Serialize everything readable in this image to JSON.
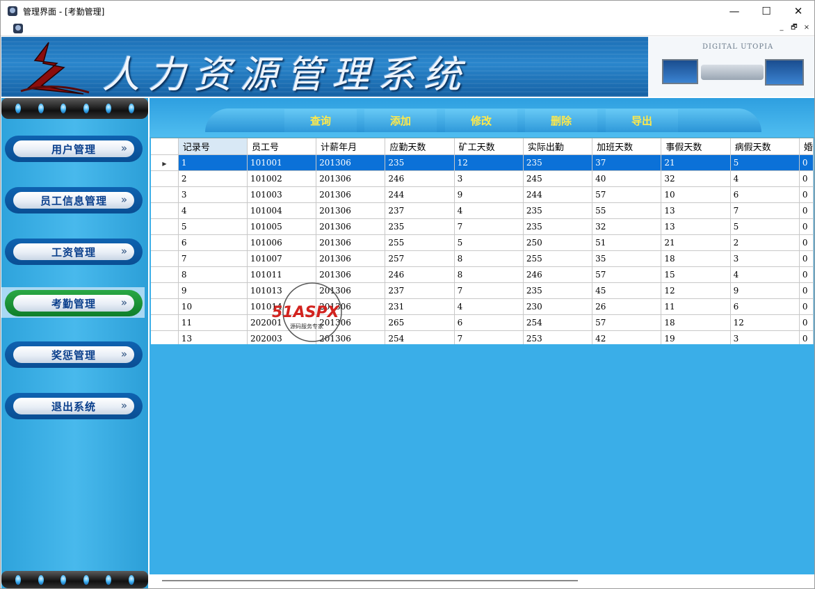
{
  "window": {
    "title": "管理界面 - [考勤管理]",
    "controls": [
      "—",
      "☐",
      "✕"
    ],
    "mdi_controls": [
      "_",
      "🗗",
      "×"
    ]
  },
  "banner": {
    "title": "人力资源管理系统",
    "brand": "DIGITAL UTOPIA"
  },
  "sidebar": {
    "items": [
      {
        "label": "用户管理",
        "active": false
      },
      {
        "label": "员工信息管理",
        "active": false
      },
      {
        "label": "工资管理",
        "active": false
      },
      {
        "label": "考勤管理",
        "active": true
      },
      {
        "label": "奖惩管理",
        "active": false
      },
      {
        "label": "退出系统",
        "active": false
      }
    ],
    "chevron": "»"
  },
  "toolbar": {
    "buttons": [
      "查询",
      "添加",
      "修改",
      "删除",
      "导出"
    ]
  },
  "grid": {
    "columns": [
      "记录号",
      "员工号",
      "计薪年月",
      "应勤天数",
      "矿工天数",
      "实际出勤",
      "加班天数",
      "事假天数",
      "病假天数",
      "婚"
    ],
    "rows": [
      [
        "1",
        "101001",
        "201306",
        "235",
        "12",
        "235",
        "37",
        "21",
        "5",
        "0"
      ],
      [
        "2",
        "101002",
        "201306",
        "246",
        "3",
        "245",
        "40",
        "32",
        "4",
        "0"
      ],
      [
        "3",
        "101003",
        "201306",
        "244",
        "9",
        "244",
        "57",
        "10",
        "6",
        "0"
      ],
      [
        "4",
        "101004",
        "201306",
        "237",
        "4",
        "235",
        "55",
        "13",
        "7",
        "0"
      ],
      [
        "5",
        "101005",
        "201306",
        "235",
        "7",
        "235",
        "32",
        "13",
        "5",
        "0"
      ],
      [
        "6",
        "101006",
        "201306",
        "255",
        "5",
        "250",
        "51",
        "21",
        "2",
        "0"
      ],
      [
        "7",
        "101007",
        "201306",
        "257",
        "8",
        "255",
        "35",
        "18",
        "3",
        "0"
      ],
      [
        "8",
        "101011",
        "201306",
        "246",
        "8",
        "246",
        "57",
        "15",
        "4",
        "0"
      ],
      [
        "9",
        "101013",
        "201306",
        "237",
        "7",
        "235",
        "45",
        "12",
        "9",
        "0"
      ],
      [
        "10",
        "101014",
        "201306",
        "231",
        "4",
        "230",
        "26",
        "11",
        "6",
        "0"
      ],
      [
        "11",
        "202001",
        "201306",
        "265",
        "6",
        "254",
        "57",
        "18",
        "12",
        "0"
      ],
      [
        "13",
        "202003",
        "201306",
        "254",
        "7",
        "253",
        "42",
        "19",
        "3",
        "0"
      ]
    ],
    "selected_row": 0,
    "sorted_column": 0
  },
  "watermark": {
    "text": "51ASPX",
    "subtext": "源码服务专家"
  },
  "colors": {
    "banner_blue": "#1c6fb5",
    "sidebar_blue": "#2ea3dc",
    "selection_blue": "#0b71d8",
    "toolbar_text": "#ffe94a",
    "active_nav_green": "#2aa845"
  }
}
